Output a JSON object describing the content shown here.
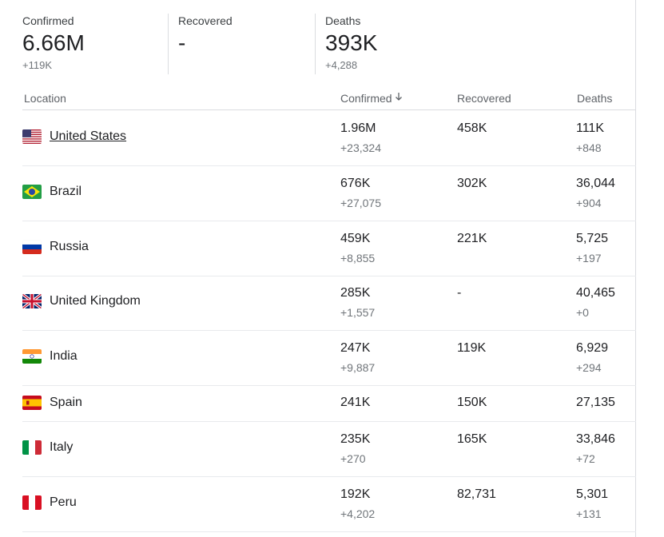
{
  "summary": {
    "confirmed": {
      "label": "Confirmed",
      "value": "6.66M",
      "delta": "+119K"
    },
    "recovered": {
      "label": "Recovered",
      "value": "-"
    },
    "deaths": {
      "label": "Deaths",
      "value": "393K",
      "delta": "+4,288"
    }
  },
  "table": {
    "headers": {
      "location": "Location",
      "confirmed": "Confirmed",
      "recovered": "Recovered",
      "deaths": "Deaths"
    },
    "sort_indicator": "arrow-down-icon",
    "rows": [
      {
        "location": "United States",
        "flag": "flag-us-icon",
        "confirmed": "1.96M",
        "confirmed_delta": "+23,324",
        "recovered": "458K",
        "deaths": "111K",
        "deaths_delta": "+848"
      },
      {
        "location": "Brazil",
        "flag": "flag-br-icon",
        "confirmed": "676K",
        "confirmed_delta": "+27,075",
        "recovered": "302K",
        "deaths": "36,044",
        "deaths_delta": "+904"
      },
      {
        "location": "Russia",
        "flag": "flag-ru-icon",
        "confirmed": "459K",
        "confirmed_delta": "+8,855",
        "recovered": "221K",
        "deaths": "5,725",
        "deaths_delta": "+197"
      },
      {
        "location": "United Kingdom",
        "flag": "flag-gb-icon",
        "confirmed": "285K",
        "confirmed_delta": "+1,557",
        "recovered": "-",
        "deaths": "40,465",
        "deaths_delta": "+0"
      },
      {
        "location": "India",
        "flag": "flag-in-icon",
        "confirmed": "247K",
        "confirmed_delta": "+9,887",
        "recovered": "119K",
        "deaths": "6,929",
        "deaths_delta": "+294"
      },
      {
        "location": "Spain",
        "flag": "flag-es-icon",
        "confirmed": "241K",
        "recovered": "150K",
        "deaths": "27,135"
      },
      {
        "location": "Italy",
        "flag": "flag-it-icon",
        "confirmed": "235K",
        "confirmed_delta": "+270",
        "recovered": "165K",
        "deaths": "33,846",
        "deaths_delta": "+72"
      },
      {
        "location": "Peru",
        "flag": "flag-pe-icon",
        "confirmed": "192K",
        "confirmed_delta": "+4,202",
        "recovered": "82,731",
        "deaths": "5,301",
        "deaths_delta": "+131"
      }
    ]
  }
}
